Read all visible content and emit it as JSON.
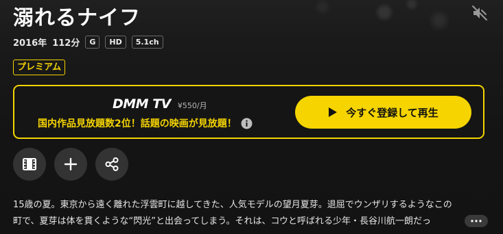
{
  "title": "溺れるナイフ",
  "meta": {
    "year": "2016年",
    "duration": "112分",
    "badges": [
      "G",
      "HD",
      "5.1ch"
    ]
  },
  "premium_label": "プレミアム",
  "promo": {
    "service_name": "DMM TV",
    "price": "¥550/月",
    "tagline": "国内作品見放題数2位！話題の映画が見放題！",
    "cta_label": "今すぐ登録して再生"
  },
  "actions": {
    "icons": [
      "film-icon",
      "plus-icon",
      "share-icon"
    ]
  },
  "synopsis": {
    "line1": "15歳の夏。東京から遠く離れた浮雲町に越してきた、人気モデルの望月夏芽。退屈でウンザリするようなこの",
    "line2": "町で、夏芽は体を貫くような“閃光”と出会ってしまう。それは、コウと呼ばれる少年・長谷川航一朗だっ"
  },
  "colors": {
    "accent": "#f5d400",
    "background": "#161616",
    "button_bg": "#333333"
  }
}
